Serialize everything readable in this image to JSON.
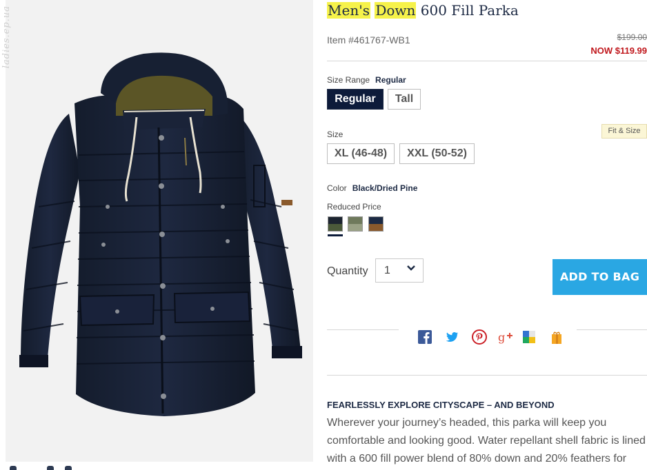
{
  "product": {
    "title_highlighted_1": "Men's",
    "title_highlighted_2": "Down",
    "title_rest": "600 Fill Parka",
    "item_number": "Item #461767-WB1",
    "price_original": "$199.00",
    "price_now": "NOW $119.99"
  },
  "watermark": "ladies.ep.ua",
  "size_range": {
    "label": "Size Range",
    "selected": "Regular",
    "options": [
      "Regular",
      "Tall"
    ]
  },
  "size": {
    "label": "Size",
    "fit_link": "Fit & Size",
    "options": [
      "XL (46-48)",
      "XXL (50-52)"
    ]
  },
  "color": {
    "label": "Color",
    "selected": "Black/Dried Pine",
    "group_label": "Reduced Price",
    "swatches": [
      {
        "name": "Black/Dried Pine",
        "top": "#1c2430",
        "bottom": "#4b5a3a"
      },
      {
        "name": "Olive",
        "top": "#6f7a5c",
        "bottom": "#9aa286"
      },
      {
        "name": "Navy/Brown",
        "top": "#1c2a44",
        "bottom": "#8a5a2c"
      }
    ]
  },
  "quantity": {
    "label": "Quantity",
    "value": "1"
  },
  "cta": {
    "add_to_bag": "ADD TO BAG"
  },
  "share_icons": [
    "facebook-icon",
    "twitter-icon",
    "pinterest-icon",
    "google-plus-icon",
    "delicious-icon",
    "gift-icon"
  ],
  "description": {
    "heading": "FEARLESSLY EXPLORE CITYSCAPE – AND BEYOND",
    "body": "Wherever your journey’s headed, this parka will keep you comfortable and looking good. Water repellant shell fabric is lined with a 600 fill power blend of 80% down and 20% feathers for"
  },
  "colors": {
    "navy": "#0d1b3a",
    "accent_blue": "#2aa7e3",
    "sale_red": "#c0171c",
    "highlight": "#f6f24a"
  }
}
